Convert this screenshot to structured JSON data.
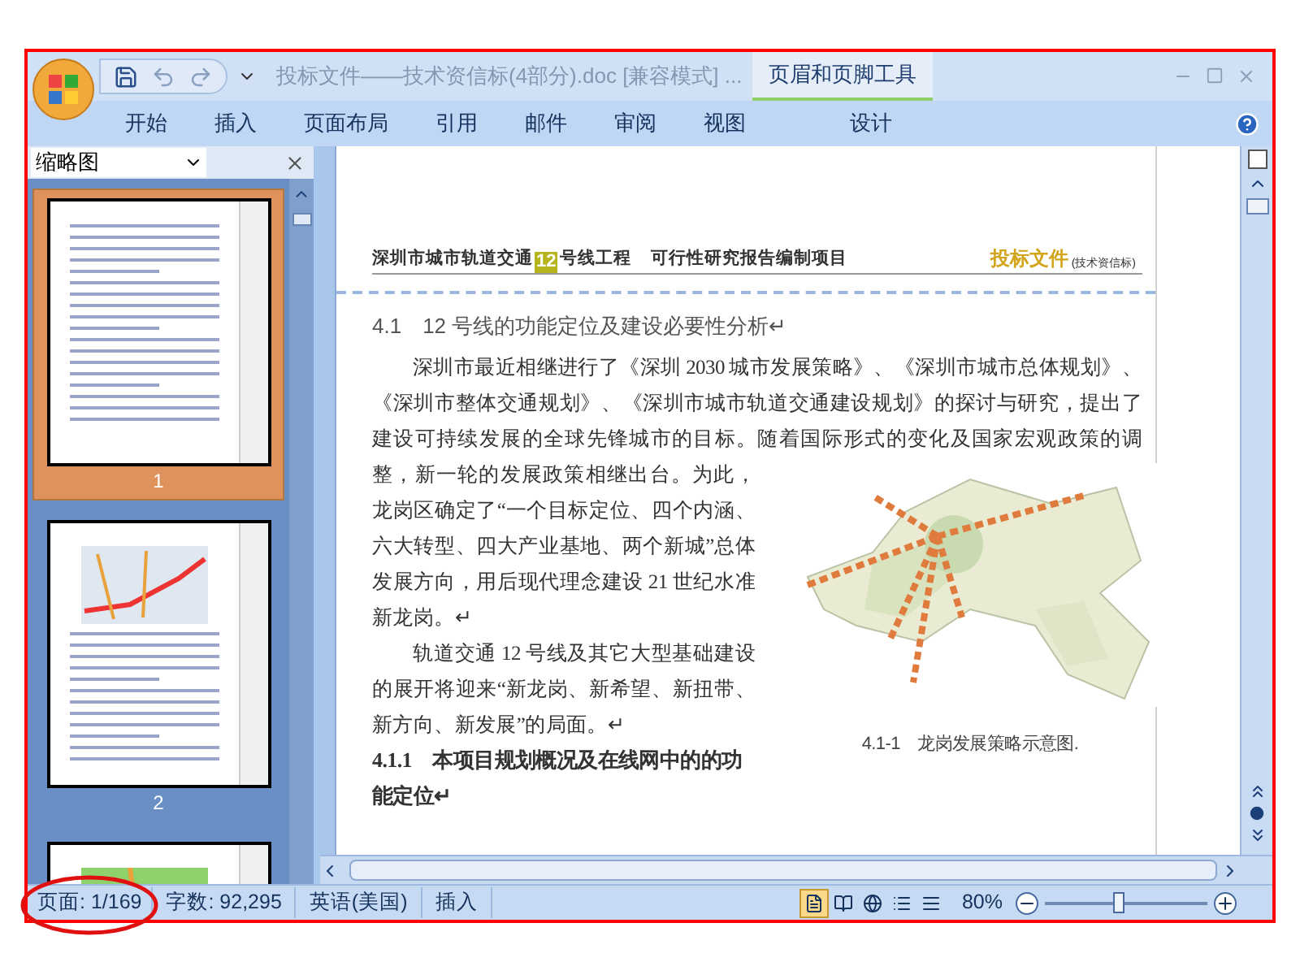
{
  "window": {
    "title": "投标文件——技术资信标(4部分).doc [兼容模式] ...",
    "contextual_tab": "页眉和页脚工具"
  },
  "ribbon_tabs": [
    {
      "label": "开始",
      "selected": false
    },
    {
      "label": "插入",
      "selected": false
    },
    {
      "label": "页面布局",
      "selected": false
    },
    {
      "label": "引用",
      "selected": false
    },
    {
      "label": "邮件",
      "selected": false
    },
    {
      "label": "审阅",
      "selected": false
    },
    {
      "label": "视图",
      "selected": false
    },
    {
      "label": "设计",
      "selected": false
    }
  ],
  "thumbnail_pane": {
    "title": "缩略图",
    "pages": [
      {
        "label": "1",
        "selected": true
      },
      {
        "label": "2",
        "selected": false
      },
      {
        "selected": false
      }
    ]
  },
  "document": {
    "header": {
      "left_before": "深圳市城市轨道交通",
      "line_number": "12",
      "left_after": "号线工程",
      "project": "可行性研究报告编制项目",
      "right": "投标文件",
      "right_note": "(技术资信标)"
    },
    "heading": "4.1　12 号线的功能定位及建设必要性分析↵",
    "intro_lines": "深圳市最近相继进行了《深圳 2030 城市发展策略》、《深圳市城市总体规划》、《深圳市整体交通规划》、《深圳市城市轨道交通建设规划》的探讨与研究，提出了建设可持续发展的全球先锋城市的目标。随着国际形式的变化及国家宏观政策的调",
    "paragraphs": [
      "整，新一轮的发展政策相继出台。为此，龙岗区确定了“一个目标定位、四个内涵、六大转型、四大产业基地、两个新城”总体发展方向，用后现代理念建设 21 世纪水准新龙岗。↵",
      "轨道交通 12 号线及其它大型基础建设的展开将迎来“新龙岗、新希望、新扭带、新方向、新发展”的局面。↵"
    ],
    "subheading": "4.1.1　本项目规划概况及在线网中的的功能定位↵",
    "figure": {
      "kind": "picture",
      "caption": "4.1-1　龙岗发展策略示意图."
    }
  },
  "status_bar": {
    "page": "页面: 1/169",
    "words": "字数: 92,295",
    "language": "英语(美国)",
    "mode": "插入",
    "views": [
      {
        "selected": true
      },
      {
        "selected": false
      },
      {
        "selected": false
      },
      {
        "selected": false
      },
      {
        "selected": false
      }
    ],
    "zoom": "80%",
    "zoom_slider": {
      "level": 0.45
    }
  }
}
